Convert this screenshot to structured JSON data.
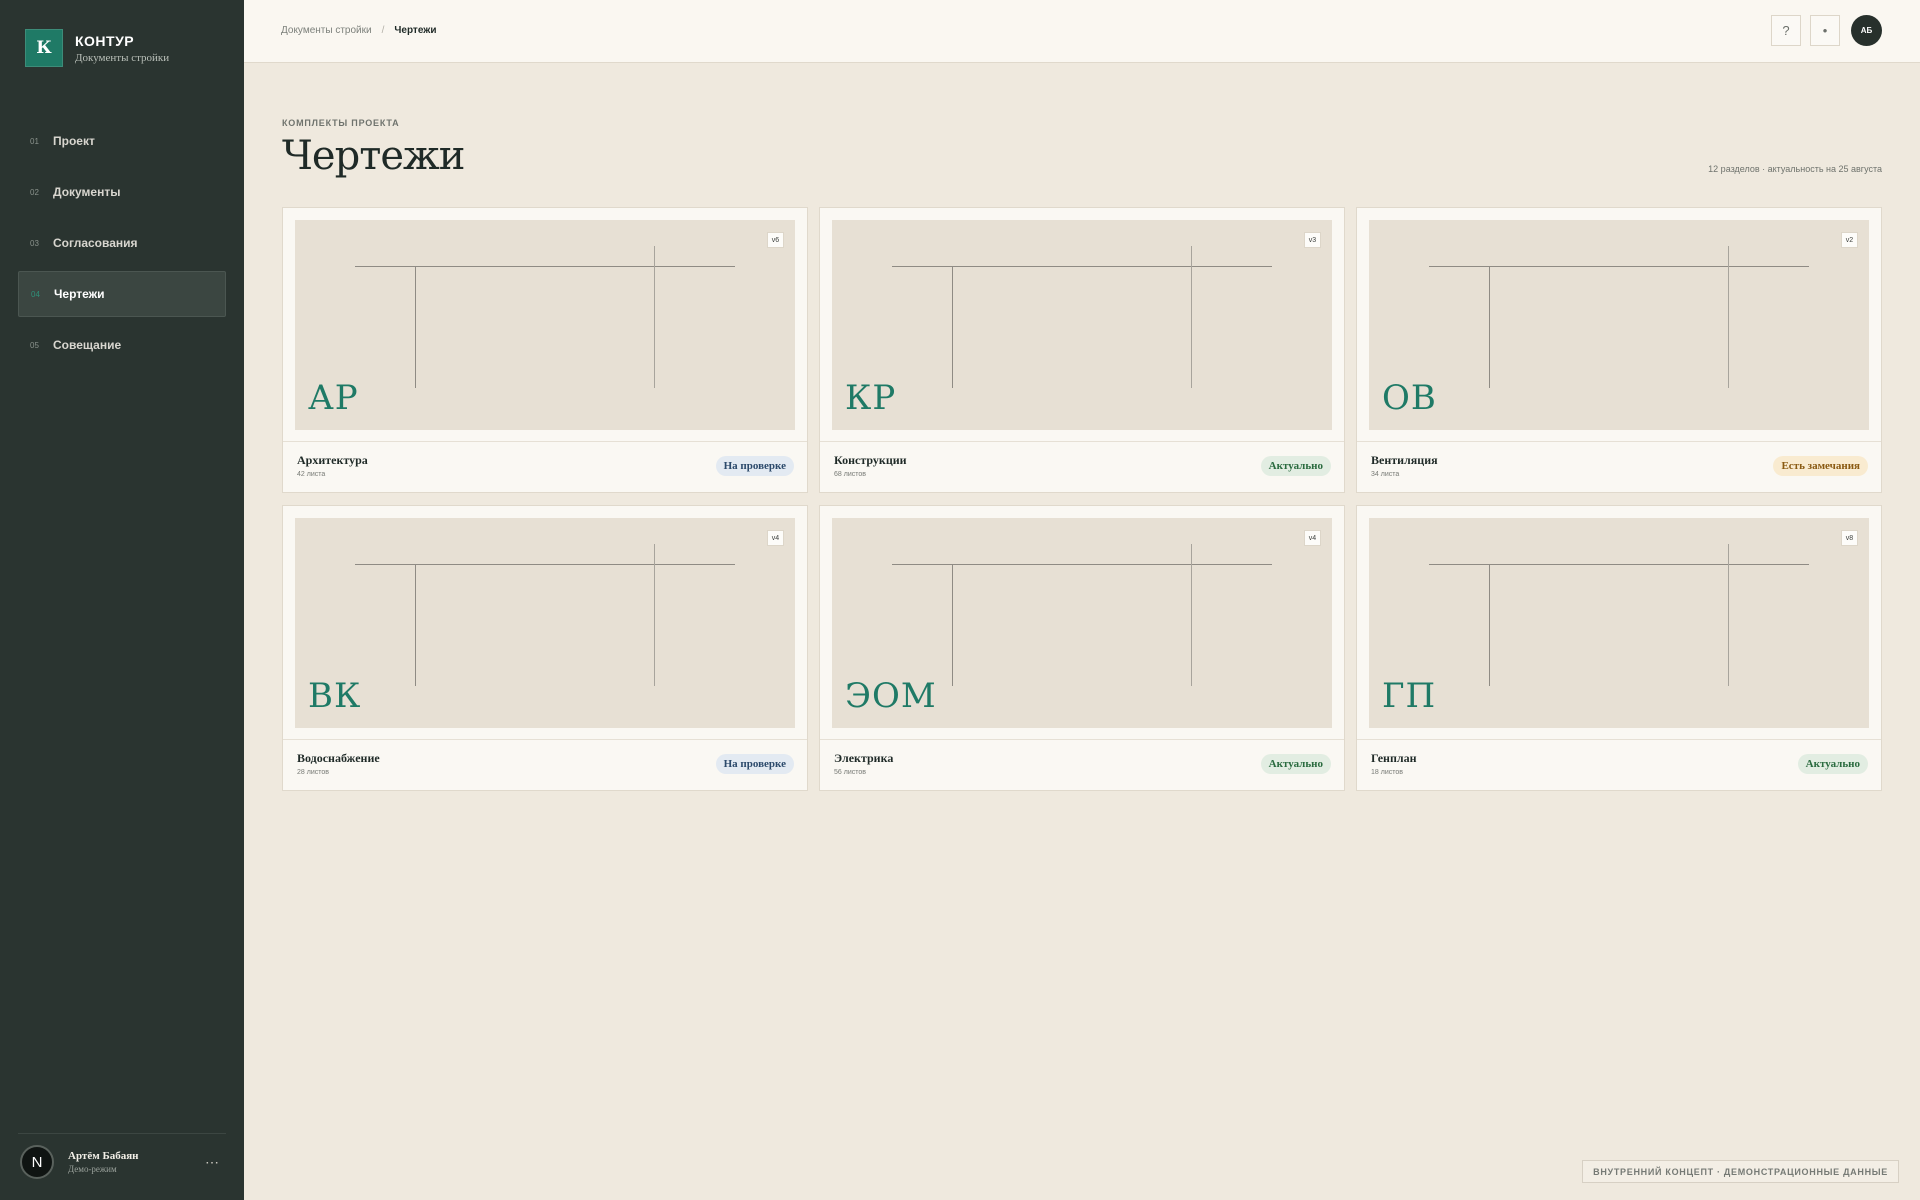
{
  "brand": {
    "mark": "К",
    "name": "КОНТУР",
    "subtitle": "Документы стройки"
  },
  "sidebar": {
    "items": [
      {
        "num": "01",
        "label": "Проект",
        "active": false
      },
      {
        "num": "02",
        "label": "Документы",
        "active": false
      },
      {
        "num": "03",
        "label": "Согласования",
        "active": false
      },
      {
        "num": "04",
        "label": "Чертежи",
        "active": true
      },
      {
        "num": "05",
        "label": "Совещание",
        "active": false
      }
    ],
    "user": {
      "avatar": "N",
      "name": "Артём Бабаян",
      "role": "Демо-режим",
      "more": "⋯"
    }
  },
  "topbar": {
    "breadcrumb": {
      "parent": "Документы стройки",
      "separator": "/",
      "current": "Чертежи"
    },
    "help_icon": "?",
    "dot_icon": "•",
    "avatar_initials": "АБ"
  },
  "page": {
    "eyebrow": "КОМПЛЕКТЫ ПРОЕКТА",
    "title": "Чертежи",
    "meta": "12 разделов · актуальность на 25 августа"
  },
  "cards": [
    {
      "code": "АР",
      "version": "v6",
      "name": "Архитектура",
      "sheets": "42 листа",
      "status": "На проверке",
      "status_kind": "review"
    },
    {
      "code": "КР",
      "version": "v3",
      "name": "Конструкции",
      "sheets": "68 листов",
      "status": "Актуально",
      "status_kind": "actual"
    },
    {
      "code": "ОВ",
      "version": "v2",
      "name": "Вентиляция",
      "sheets": "34 листа",
      "status": "Есть замечания",
      "status_kind": "remarks"
    },
    {
      "code": "ВК",
      "version": "v4",
      "name": "Водоснабжение",
      "sheets": "28 листов",
      "status": "На проверке",
      "status_kind": "review"
    },
    {
      "code": "ЭОМ",
      "version": "v4",
      "name": "Электрика",
      "sheets": "56 листов",
      "status": "Актуально",
      "status_kind": "actual"
    },
    {
      "code": "ГП",
      "version": "v8",
      "name": "Генплан",
      "sheets": "18 листов",
      "status": "Актуально",
      "status_kind": "actual"
    }
  ],
  "footer_tag": "ВНУТРЕННИЙ КОНЦЕПТ · ДЕМОНСТРАЦИОННЫЕ ДАННЫЕ",
  "colors": {
    "sidebar_bg": "#2a3430",
    "accent": "#1f7a66",
    "page_bg": "#efe9de",
    "badge_review": "#e3eaf2",
    "badge_actual": "#e2ede2",
    "badge_remarks": "#f9ebd0"
  }
}
